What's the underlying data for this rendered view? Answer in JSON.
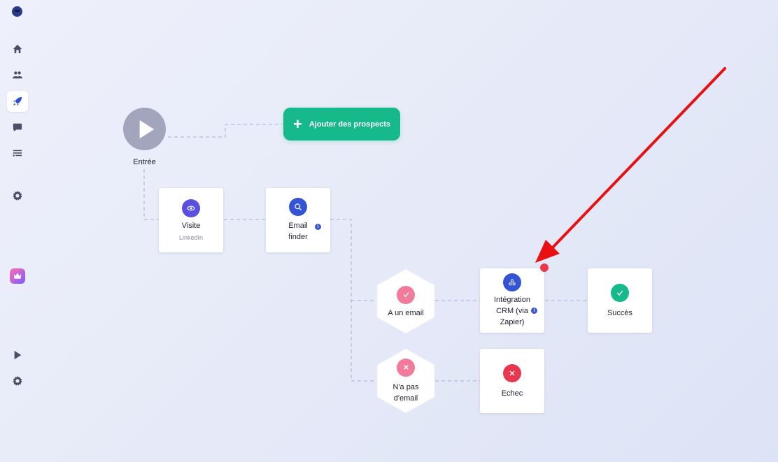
{
  "sidebar": {
    "items": [
      {
        "icon": "home-icon"
      },
      {
        "icon": "users-icon"
      },
      {
        "icon": "rocket-icon",
        "active": true
      },
      {
        "icon": "chat-icon"
      },
      {
        "icon": "list-icon"
      },
      {
        "icon": "gear-icon"
      },
      {
        "icon": "play-icon"
      },
      {
        "icon": "gear-icon"
      }
    ]
  },
  "flow": {
    "start_label": "Entrée",
    "add_prospects_label": "Ajouter des prospects",
    "visit": {
      "title": "Visite",
      "subtitle": "LinkedIn"
    },
    "email_finder": {
      "title_line1": "Email",
      "title_line2": "finder",
      "info": "i"
    },
    "has_email": {
      "label": "A un email"
    },
    "no_email": {
      "label_line1": "N'a pas",
      "label_line2": "d'email"
    },
    "crm": {
      "line1": "Intégration",
      "line2": "CRM (via",
      "line3": "Zapier)",
      "info": "i"
    },
    "success": {
      "label": "Succès"
    },
    "failure": {
      "label": "Echec"
    }
  },
  "colors": {
    "accent": "#2f4fd9",
    "success": "#16b98a",
    "danger": "#e8384f",
    "pink": "#f27a9b",
    "purple": "#5b4fe0",
    "annotation_arrow": "#e81010"
  }
}
